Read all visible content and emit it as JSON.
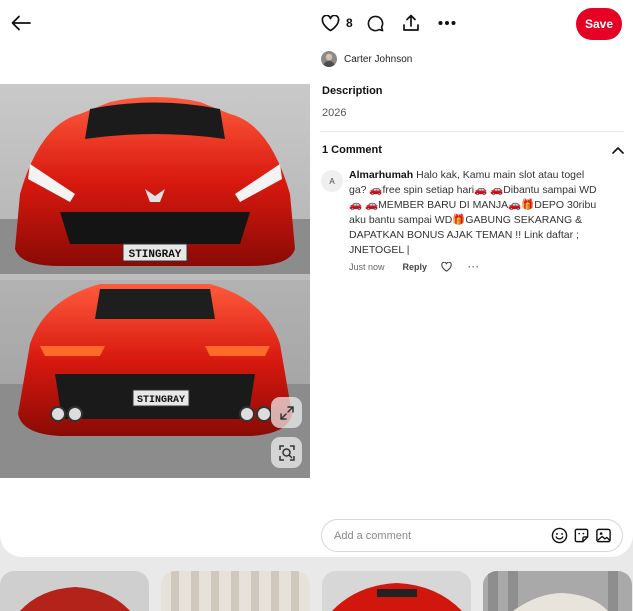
{
  "header": {
    "back_icon": "arrow-left-icon",
    "likes_count": "8",
    "save_label": "Save",
    "accent_color": "#e60023"
  },
  "pin": {
    "plate_text_front": "STINGRAY",
    "plate_text_rear": "STINGRAY",
    "car_color": "#d8190f",
    "expand_icon": "expand-icon",
    "visual_search_icon": "visual-search-icon"
  },
  "author": {
    "name": "Carter Johnson"
  },
  "description": {
    "title": "Description",
    "text": "2026"
  },
  "comments": {
    "title": "1 Comment",
    "items": [
      {
        "avatar_initial": "A",
        "user": "Almarhumah",
        "text": "Halo kak, Kamu main slot atau togel ga? 🚗free spin setiap hari🚗 🚗Dibantu sampai WD🚗 🚗MEMBER BARU DI MANJA🚗🎁DEPO 30ribu aku bantu sampai WD🎁GABUNG SEKARANG & DAPATKAN BONUS AJAK TEMAN !! Link daftar ; JNETOGEL |",
        "time": "Just now",
        "reply_label": "Reply",
        "more_label": "···"
      }
    ]
  },
  "comment_box": {
    "placeholder": "Add a comment"
  }
}
